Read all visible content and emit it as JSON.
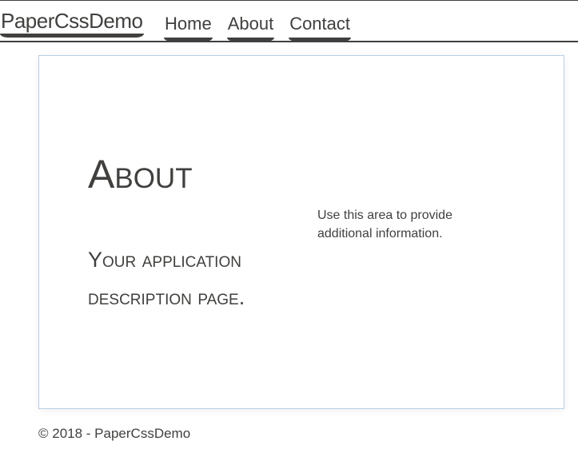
{
  "navbar": {
    "brand": "PaperCssDemo",
    "links": [
      {
        "label": "Home"
      },
      {
        "label": "About"
      },
      {
        "label": "Contact"
      }
    ]
  },
  "main": {
    "heading": "About",
    "description": "Your application description page.",
    "side_note": "Use this area to provide additional information."
  },
  "footer": {
    "text": "© 2018 - PaperCssDemo"
  },
  "colors": {
    "text": "#41403e",
    "card_border": "#b8cfe4",
    "background": "#ffffff"
  }
}
